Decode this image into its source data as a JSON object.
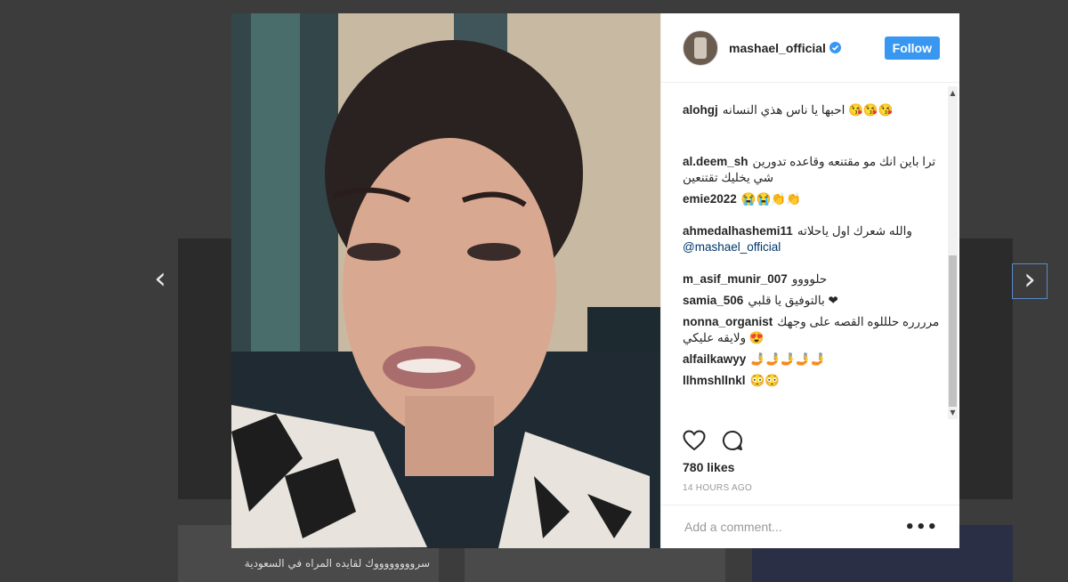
{
  "post": {
    "username": "mashael_official",
    "follow_label": "Follow",
    "likes": "780 likes",
    "time": "14 HOURS AGO",
    "comment_placeholder": "Add a comment...",
    "more_label": "•••"
  },
  "comments": [
    {
      "user": "alohgj",
      "text": "احبها يا ناس هذي النسانه 😘😘😘"
    },
    {
      "user": "al.deem_sh",
      "text": "ترا باين انك مو مقتنعه وقاعده تدورين شي يخليك تقتنعين"
    },
    {
      "user": "emie2022",
      "text": "😭😭👏👏"
    },
    {
      "user": "ahmedalhashemi11",
      "text": "والله شعرك اول ياحلاته",
      "mention": "@mashael_official"
    },
    {
      "user": "m_asif_munir_007",
      "text": "حلوووو"
    },
    {
      "user": "samia_506",
      "text": "بالتوفيق يا قلبي ❤"
    },
    {
      "user": "nonna_organist",
      "text": "مرررره حلللوه القصه على وجهك 😍 ولايقه عليكي"
    },
    {
      "user": "alfailkawyy",
      "text": "🤳🤳🤳🤳🤳"
    },
    {
      "user": "llhmshllnkl",
      "text": "😳😳"
    }
  ],
  "background": {
    "caption": "سرووووووووك لقايده المراه في السعودية"
  },
  "icons": {
    "left_arrow": "‹",
    "right_arrow": "›",
    "heart": "heart-icon",
    "comment": "comment-icon",
    "verified": "verified-badge-icon"
  },
  "colors": {
    "accent": "#3897f0",
    "overlay": "#3c3c3c"
  }
}
